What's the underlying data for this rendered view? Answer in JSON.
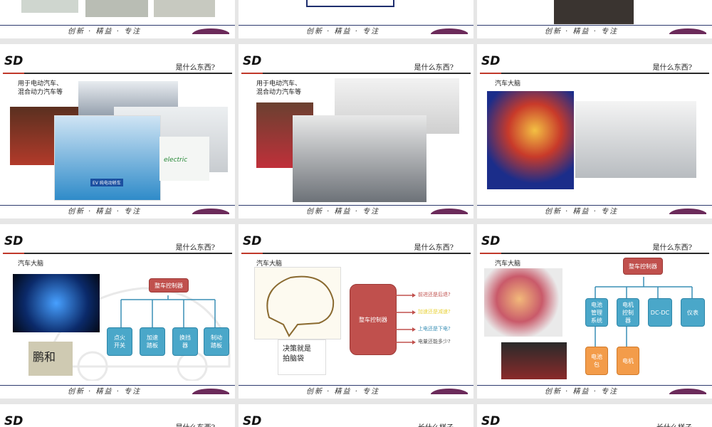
{
  "footer": {
    "slogan": "创新 · 精益 · 专注"
  },
  "slides": [
    {
      "title": "是什么东西?",
      "caption": "用于电动汽车、\n混合动力汽车等",
      "img_text": "EV 纯电动轿车",
      "img_text2": "electric"
    },
    {
      "title": "是什么东西?",
      "caption": "用于电动汽车、\n混合动力汽车等"
    },
    {
      "title": "是什么东西?",
      "caption": "汽车大脑"
    },
    {
      "title": "是什么东西?",
      "caption": "汽车大脑",
      "calligraphy": "鹏和",
      "controller": "整车控制器",
      "inputs": [
        "点火\n开关",
        "加速\n踏板",
        "换挡\n器",
        "制动\n踏板"
      ]
    },
    {
      "title": "是什么东西?",
      "caption": "汽车大脑",
      "calligraphy": "决策就是\n拍脑袋",
      "controller": "整车控制器",
      "decisions": [
        "前进还是后退?",
        "加速还是减速?",
        "上电还是下电?",
        "电量还能多少?"
      ]
    },
    {
      "title": "是什么东西?",
      "caption": "汽车大脑",
      "controller": "整车控制器",
      "outputs": [
        "电池\n管理\n系统",
        "电机\n控制\n器",
        "DC-DC",
        "仪表"
      ],
      "sub": [
        "电池\n包",
        "电机"
      ]
    },
    {
      "title": "是什么东西?"
    },
    {
      "title": "长什么样子"
    },
    {
      "title": "长什么样子"
    }
  ]
}
